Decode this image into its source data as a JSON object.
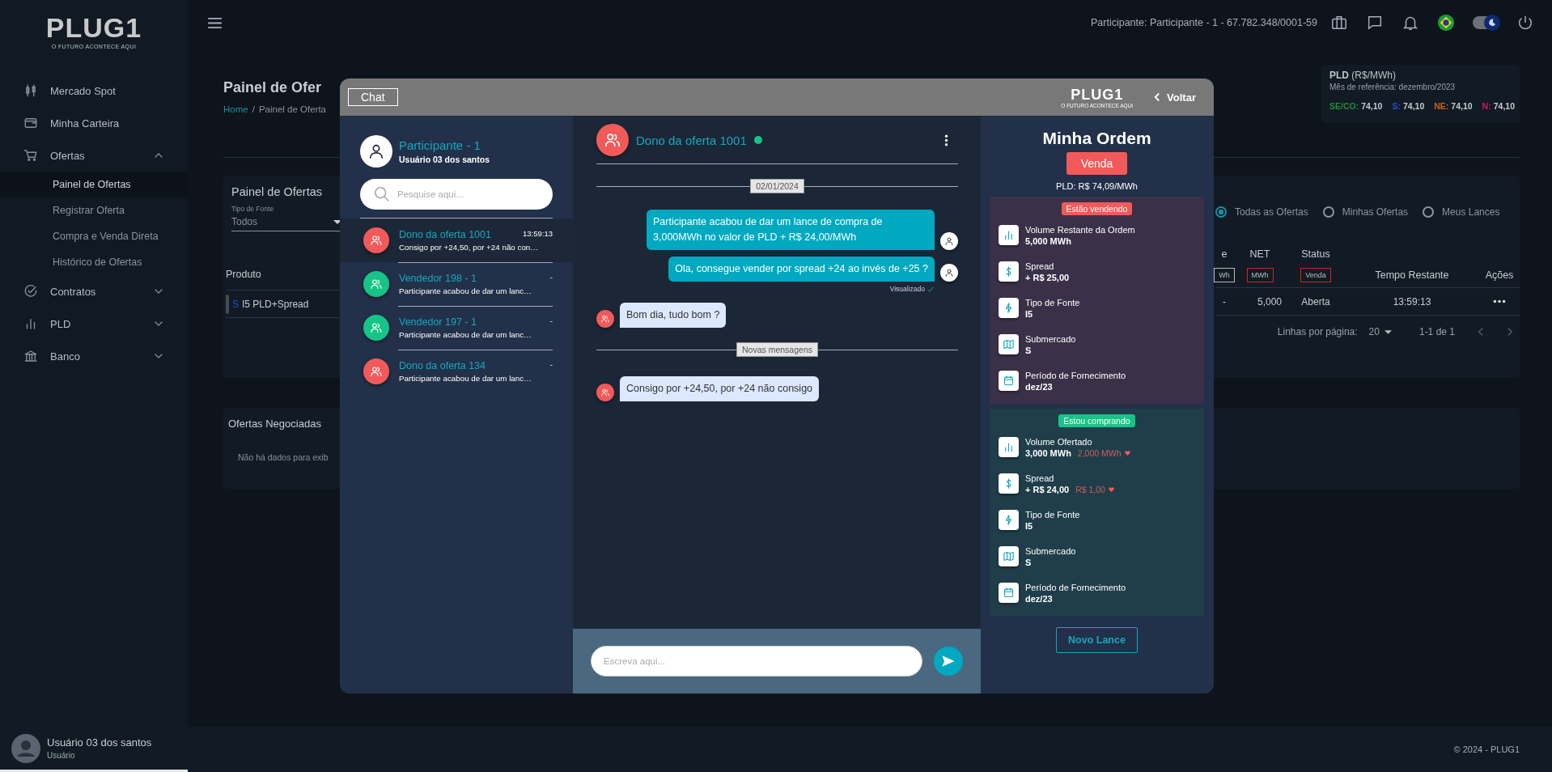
{
  "topbar": {
    "participant": "Participante: Participante - 1 - 67.782.348/0001-59",
    "dark_mode": true
  },
  "sidebar": {
    "logo": "PLUG1",
    "tagline": "O FUTURO ACONTECE AQUI",
    "items": [
      {
        "label": "Mercado Spot",
        "kind": "link"
      },
      {
        "label": "Minha Carteira",
        "kind": "link"
      },
      {
        "label": "Ofertas",
        "kind": "group",
        "expanded": true,
        "children": [
          {
            "label": "Painel de Ofertas",
            "selected": true
          },
          {
            "label": "Registrar Oferta",
            "selected": false
          },
          {
            "label": "Compra e Venda Direta",
            "selected": false
          },
          {
            "label": "Histórico de Ofertas",
            "selected": false
          }
        ]
      },
      {
        "label": "Contratos",
        "kind": "group",
        "expanded": false
      },
      {
        "label": "PLD",
        "kind": "group",
        "expanded": false
      },
      {
        "label": "Banco",
        "kind": "group",
        "expanded": false
      }
    ],
    "user": {
      "name": "Usuário 03 dos santos",
      "role": "Usuário"
    }
  },
  "page": {
    "title": "Painel de Ofer",
    "breadcrumb": [
      "Home",
      "Painel de Oferta"
    ],
    "breadcrumb_separator": "/",
    "pld_card": {
      "title": "PLD",
      "unit": "(R$/MWh)",
      "reference": "Mês de referência: dezembro/2023",
      "regions": [
        {
          "label": "SE/CO:",
          "value": "74,10",
          "color": "#1f8f3a"
        },
        {
          "label": "S:",
          "value": "74,10",
          "color": "#2450c8"
        },
        {
          "label": "NE:",
          "value": "74,10",
          "color": "#c8621c"
        },
        {
          "label": "N:",
          "value": "74,10",
          "color": "#d0186a"
        }
      ]
    },
    "offers_panel": {
      "title": "Painel de Ofertas",
      "filter": {
        "label": "Tipo de Fonte",
        "value": "Todos"
      },
      "views": [
        {
          "label": "Todas as Ofertas",
          "selected": true
        },
        {
          "label": "Minhas Ofertas",
          "selected": false
        },
        {
          "label": "Meus Lances",
          "selected": false
        }
      ],
      "product_column": "Produto",
      "columns": [
        {
          "label": "e",
          "unit": "Wh",
          "highlighted": false
        },
        {
          "label": "NET",
          "unit": "MWh",
          "highlighted": true
        },
        {
          "label": "Status",
          "unit": "Venda",
          "highlighted": true
        },
        {
          "label": "Tempo Restante"
        },
        {
          "label": "Ações"
        }
      ],
      "rows": [
        {
          "source": "S",
          "product": "I5 PLD+Spread",
          "cells": [
            "-",
            "5,000",
            "Aberta",
            "13:59:13"
          ]
        }
      ],
      "pagination": {
        "rows_label": "Linhas por página:",
        "rows_value": "20",
        "range": "1-1 de 1"
      }
    },
    "negotiated": {
      "title": "Ofertas Negociadas",
      "empty": "Não há dados para exib"
    }
  },
  "chat": {
    "title": "Chat",
    "logo": "PLUG1",
    "tagline": "O FUTURO ACONTECE AQUI",
    "back": "Voltar",
    "me": {
      "name": "Participante - 1",
      "user": "Usuário 03 dos santos"
    },
    "search": {
      "placeholder": "Pesquise aqui..."
    },
    "conversations": [
      {
        "name": "Dono da oferta 1001",
        "time": "13:59:13",
        "preview": "Consigo por +24,50, por +24 não con…",
        "color": "#f25a5a",
        "selected": true
      },
      {
        "name": "Vendedor 198 - 1",
        "time": "-",
        "preview": "Participante acabou de dar um lanc…",
        "color": "#17c487",
        "selected": false
      },
      {
        "name": "Vendedor 197 - 1",
        "time": "-",
        "preview": "Participante acabou de dar um lanc…",
        "color": "#17c487",
        "selected": false
      },
      {
        "name": "Dono da oferta 134",
        "time": "-",
        "preview": "Participante acabou de dar um lanc…",
        "color": "#f25a5a",
        "selected": false
      }
    ],
    "thread": {
      "name": "Dono da oferta 1001",
      "online": true,
      "color": "#f25a5a",
      "items": [
        {
          "kind": "date",
          "text": "02/01/2024"
        },
        {
          "kind": "sent",
          "text": "Participante acabou de dar um lance de compra de 3,000MWh no valor de PLD + R$ 24,00/MWh"
        },
        {
          "kind": "sent",
          "text": "Ola, consegue vender por spread +24 ao invés de +25 ?",
          "status": "Visualizado"
        },
        {
          "kind": "received",
          "text": "Bom dia, tudo bom ?"
        },
        {
          "kind": "divider",
          "text": "Novas mensagens"
        },
        {
          "kind": "received",
          "text": "Consigo por +24,50, por +24 não consigo"
        }
      ]
    },
    "composer": {
      "placeholder": "Escreva aqui..."
    },
    "order": {
      "title": "Minha Ordem",
      "side": "Venda",
      "pld": "PLD: R$ 74,09/MWh",
      "sections": [
        {
          "kind": "selling",
          "badge": "Estão vendendo",
          "fields": [
            {
              "label": "Volume Restante da Ordem",
              "value": "5,000 MWh"
            },
            {
              "label": "Spread",
              "value": "+ R$ 25,00"
            },
            {
              "label": "Tipo de Fonte",
              "value": "I5"
            },
            {
              "label": "Submercado",
              "value": "S"
            },
            {
              "label": "Período de Fornecimento",
              "value": "dez/23"
            }
          ]
        },
        {
          "kind": "buying",
          "badge": "Estou comprando",
          "fields": [
            {
              "label": "Volume Ofertado",
              "value": "3,000 MWh",
              "difference": "2,000 MWh"
            },
            {
              "label": "Spread",
              "value": "+ R$ 24,00",
              "difference": "R$ 1,00"
            },
            {
              "label": "Tipo de Fonte",
              "value": "I5"
            },
            {
              "label": "Submercado",
              "value": "S"
            },
            {
              "label": "Período de Fornecimento",
              "value": "dez/23"
            }
          ]
        }
      ],
      "action": "Novo Lance"
    }
  },
  "footer": {
    "copyright": "© 2024 - PLUG1"
  }
}
